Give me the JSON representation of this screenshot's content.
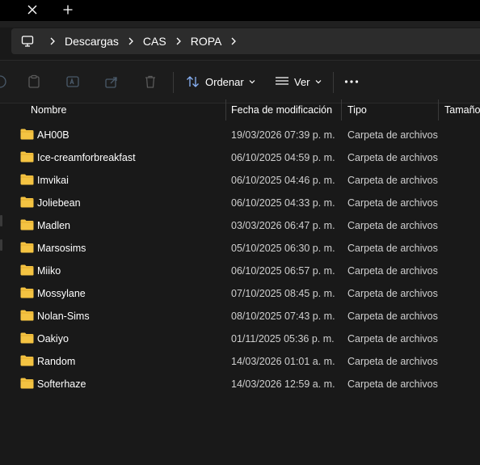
{
  "tabbar": {
    "close_icon": "close-icon",
    "new_tab_icon": "plus-icon"
  },
  "address": {
    "root_icon": "computer-icon",
    "crumbs": [
      "Descargas",
      "CAS",
      "ROPA"
    ]
  },
  "toolbar": {
    "sort_label": "Ordenar",
    "view_label": "Ver",
    "more_icon": "more-icon"
  },
  "columns": {
    "name": "Nombre",
    "date": "Fecha de modificación",
    "type": "Tipo",
    "size": "Tamaño"
  },
  "files": [
    {
      "name": "AH00B",
      "date": "19/03/2026 07:39 p. m.",
      "type": "Carpeta de archivos"
    },
    {
      "name": "Ice-creamforbreakfast",
      "date": "06/10/2025 04:59 p. m.",
      "type": "Carpeta de archivos"
    },
    {
      "name": "Imvikai",
      "date": "06/10/2025 04:46 p. m.",
      "type": "Carpeta de archivos"
    },
    {
      "name": "Joliebean",
      "date": "06/10/2025 04:33 p. m.",
      "type": "Carpeta de archivos"
    },
    {
      "name": "Madlen",
      "date": "03/03/2026 06:47 p. m.",
      "type": "Carpeta de archivos"
    },
    {
      "name": "Marsosims",
      "date": "05/10/2025 06:30 p. m.",
      "type": "Carpeta de archivos"
    },
    {
      "name": "Miiko",
      "date": "06/10/2025 06:57 p. m.",
      "type": "Carpeta de archivos"
    },
    {
      "name": "Mossylane",
      "date": "07/10/2025 08:45 p. m.",
      "type": "Carpeta de archivos"
    },
    {
      "name": "Nolan-Sims",
      "date": "08/10/2025 07:43 p. m.",
      "type": "Carpeta de archivos"
    },
    {
      "name": "Oakiyo",
      "date": "01/11/2025 05:36 p. m.",
      "type": "Carpeta de archivos"
    },
    {
      "name": "Random",
      "date": "14/03/2026 01:01 a. m.",
      "type": "Carpeta de archivos"
    },
    {
      "name": "Softerhaze",
      "date": "14/03/2026 12:59 a. m.",
      "type": "Carpeta de archivos"
    }
  ],
  "colors": {
    "folder": "#f4c342",
    "background": "#191919",
    "toolbar": "#1c1c1c",
    "address": "#2c2c2c"
  }
}
